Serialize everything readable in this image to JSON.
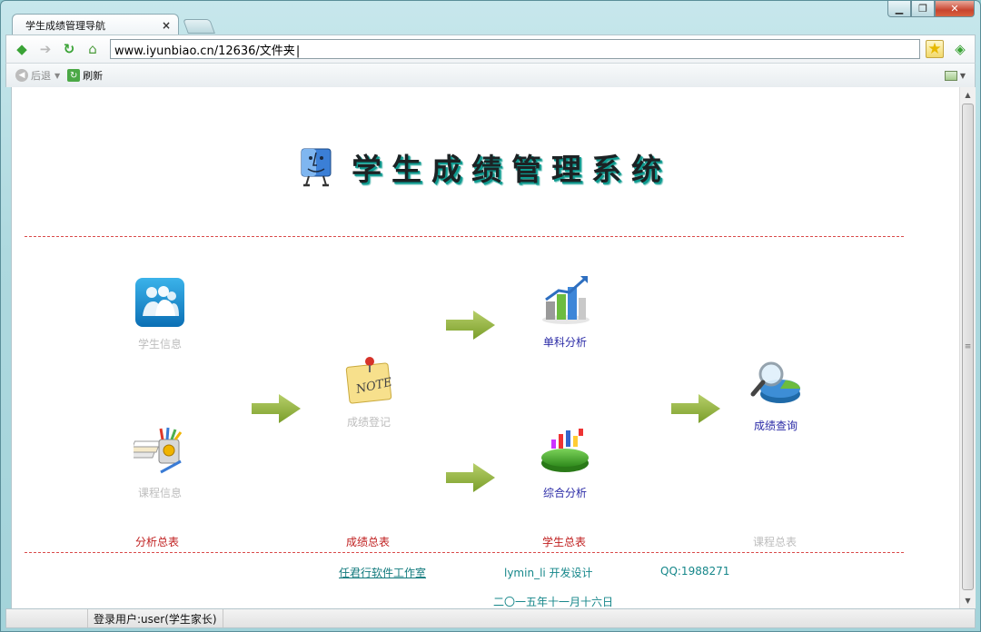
{
  "browser": {
    "tab_title": "学生成绩管理导航",
    "tab_close": "×",
    "address": "www.iyunbiao.cn/12636/文件夹",
    "toolbar_back": "后退",
    "toolbar_refresh": "刷新",
    "status_user": "登录用户:user(学生家长)"
  },
  "page": {
    "title": "学生成绩管理系统",
    "modules": {
      "student_info": "学生信息",
      "course_info": "课程信息",
      "score_register": "成绩登记",
      "single_analysis": "单科分析",
      "overall_analysis": "综合分析",
      "score_query": "成绩查询"
    },
    "summaries": {
      "analysis": "分析总表",
      "score": "成绩总表",
      "student": "学生总表",
      "course": "课程总表"
    },
    "footer": {
      "studio": "任君行软件工作室",
      "designer": "lymin_li 开发设计",
      "qq": "QQ:1988271",
      "date": "二〇一五年十一月十六日"
    }
  },
  "colors": {
    "title_shadow": "#0e9a8f",
    "dash_line": "#d94a4a",
    "link_label": "#2a2aa6",
    "dim_label": "#bdbdbd",
    "summary_red": "#c02020",
    "footer_teal": "#16878a",
    "arrow_green": "#8fb33c"
  },
  "icons": {
    "back": "back-arrow-icon",
    "forward": "forward-arrow-icon",
    "reload": "reload-icon",
    "home": "home-icon",
    "favorite": "star-icon",
    "go": "go-icon",
    "student_info": "users-icon",
    "course_info": "books-pencils-icon",
    "score_register": "note-pin-icon",
    "single_analysis": "bar-chart-icon",
    "overall_analysis": "pie-chart-icon",
    "score_query": "magnifier-chart-icon"
  }
}
